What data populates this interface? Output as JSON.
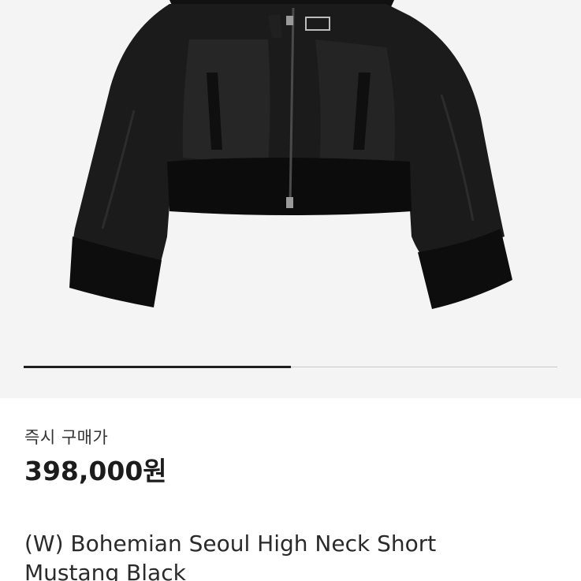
{
  "product": {
    "image_alt": "Black leather jacket with shearling collar and cuffs",
    "carousel_progress": 0.5
  },
  "price_section": {
    "label": "즉시 구매가",
    "price": "398,000원"
  },
  "title": {
    "name": "(W) Bohemian Seoul High Neck Short Mustang Black"
  },
  "colors": {
    "image_background": "#f4f4f4",
    "progress_track": "#c8c8c8",
    "progress_fill": "#1f1f1f",
    "text_primary": "#1c1c1c"
  }
}
